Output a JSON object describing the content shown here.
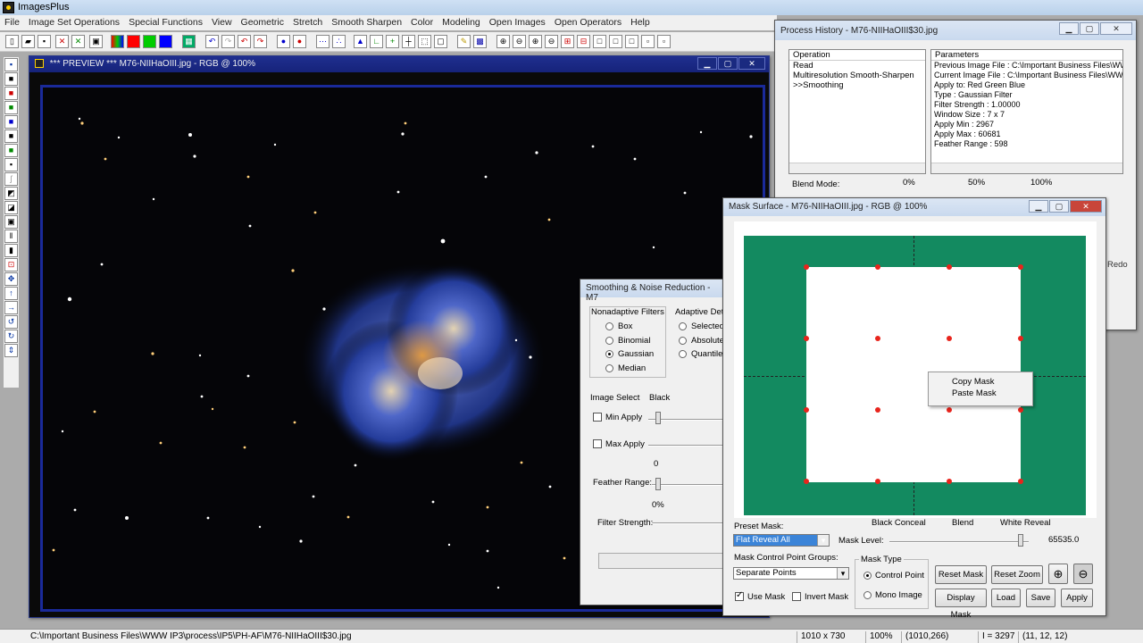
{
  "app": {
    "title": "ImagesPlus"
  },
  "menu": [
    "File",
    "Image Set Operations",
    "Special Functions",
    "View",
    "Geometric",
    "Stretch",
    "Smooth Sharpen",
    "Color",
    "Modeling",
    "Open Images",
    "Open Operators",
    "Help"
  ],
  "preview": {
    "title": "*** PREVIEW *** M76-NIIHaOIII.jpg - RGB @ 100%"
  },
  "history": {
    "title": "Process History - M76-NIIHaOIII$30.jpg",
    "op_header": "Operation",
    "param_header": "Parameters",
    "operations": [
      "Read",
      "Multiresolution Smooth-Sharpen",
      ">>Smoothing"
    ],
    "parameters": [
      "Previous Image File : C:\\Important Business Files\\WW...",
      "Current Image File : C:\\Important Business Files\\WW...",
      "Apply to:  Red Green Blue",
      "Type : Gaussian Filter",
      "Filter Strength : 1.00000",
      "Window Size : 7 x 7",
      "Apply Min : 2967",
      "Apply Max : 60681",
      "Feather Range : 598"
    ],
    "blend_label": "Blend Mode:",
    "ticks": [
      "0%",
      "50%",
      "100%"
    ],
    "redo": "Redo"
  },
  "smoothing": {
    "title": "Smoothing & Noise Reduction - M7",
    "nonadaptive_label": "Nonadaptive Filters",
    "adaptive_label": "Adaptive Det",
    "filters": [
      "Box",
      "Binomial",
      "Gaussian",
      "Median"
    ],
    "selected_filter": "Gaussian",
    "adaptive_options": [
      "Selected",
      "Absolute",
      "Quantile"
    ],
    "image_select": "Image Select",
    "black": "Black",
    "min_apply": "Min Apply",
    "max_apply": "Max Apply",
    "feather_range": "Feather Range:",
    "feather_value": "0",
    "filter_strength": "Filter Strength:",
    "strength_tick": "0%"
  },
  "mask": {
    "title": "Mask Surface - M76-NIIHaOIII.jpg - RGB @ 100%",
    "context_menu": [
      "Copy Mask",
      "Paste Mask"
    ],
    "preset_label": "Preset Mask:",
    "preset_value": "Flat Reveal All",
    "black_conceal": "Black Conceal",
    "blend": "Blend",
    "white_reveal": "White Reveal",
    "mask_level_label": "Mask Level:",
    "mask_level_value": "65535.0",
    "groups_label": "Mask Control Point Groups:",
    "groups_value": "Separate Points",
    "mask_type_label": "Mask Type",
    "control_point": "Control Point",
    "mono_image": "Mono Image",
    "use_mask": "Use Mask",
    "invert_mask": "Invert Mask",
    "reset_mask": "Reset Mask",
    "reset_zoom": "Reset Zoom",
    "display_mask": "Display Mask",
    "load": "Load",
    "save": "Save",
    "apply": "Apply",
    "colors": {
      "surface": "#138a60",
      "point": "#e8241c"
    }
  },
  "status": {
    "path": "C:\\Important Business Files\\WWW IP3\\process\\IP5\\PH-AF\\M76-NIIHaOIII$30.jpg",
    "size": "1010 x 730",
    "zoom": "100%",
    "coords": "(1010,266)",
    "intensity": "I = 3297",
    "rgb": "(11, 12, 12)"
  }
}
